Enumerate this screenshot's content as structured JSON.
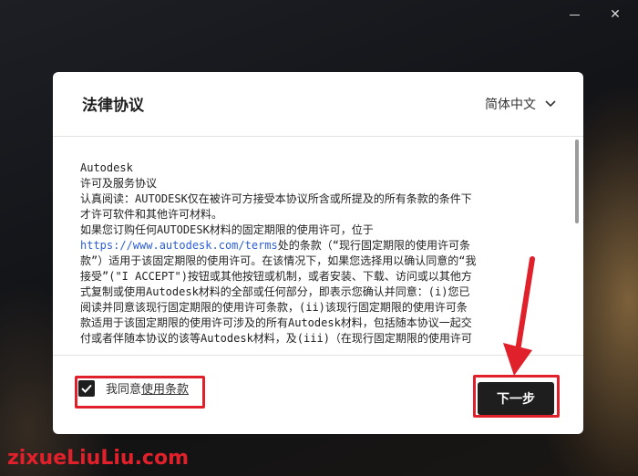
{
  "window": {
    "minimize_glyph": "—",
    "close_glyph": "✕"
  },
  "dialog": {
    "title": "法律协议",
    "language": "简体中文",
    "license_lines": [
      "Autodesk",
      "许可及服务协议",
      "认真阅读：AUTODESK仅在被许可方接受本协议所含或所提及的所有条款的条件下",
      "才许可软件和其他许可材料。",
      "如果您订购任何AUTODESK材料的固定期限的使用许可，位于",
      "https://www.autodesk.com/terms处的条款（“现行固定期限的使用许可条",
      "款”）适用于该固定期限的使用许可。在该情况下，如果您选择用以确认同意的“我",
      "接受”(\"I ACCEPT\")按钮或其他按钮或机制，或者安装、下载、访问或以其他方",
      "式复制或使用Autodesk材料的全部或任何部分，即表示您确认并同意：(i)您已",
      "阅读并同意该现行固定期限的使用许可条款，(ii)该现行固定期限的使用许可条",
      "款适用于该固定期限的使用许可涉及的所有Autodesk材料，包括随本协议一起交",
      "付或者伴随本协议的该等Autodesk材料，及(iii)（在现行固定期限的使用许可"
    ],
    "terms_url": "https://www.autodesk.com/terms",
    "agree_prefix": "我同意",
    "agree_link": "使用条款",
    "next_label": "下一步"
  },
  "watermark": "zixueLiuLiu.com",
  "colors": {
    "highlight": "#e0202a",
    "button_bg": "#1e1e1e",
    "link": "#2c5fd6"
  }
}
